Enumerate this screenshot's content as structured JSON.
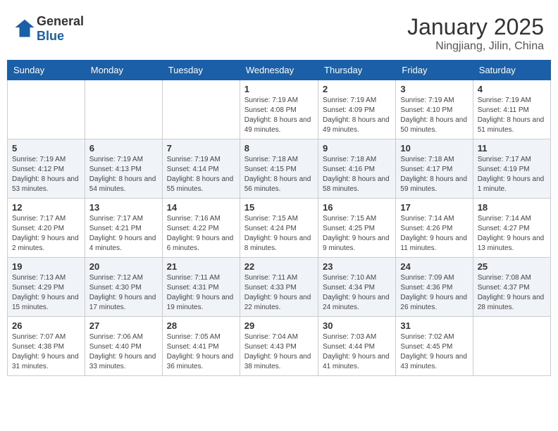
{
  "logo": {
    "general": "General",
    "blue": "Blue"
  },
  "title": "January 2025",
  "location": "Ningjiang, Jilin, China",
  "days_of_week": [
    "Sunday",
    "Monday",
    "Tuesday",
    "Wednesday",
    "Thursday",
    "Friday",
    "Saturday"
  ],
  "weeks": [
    [
      {
        "day": "",
        "sunrise": "",
        "sunset": "",
        "daylight": ""
      },
      {
        "day": "",
        "sunrise": "",
        "sunset": "",
        "daylight": ""
      },
      {
        "day": "",
        "sunrise": "",
        "sunset": "",
        "daylight": ""
      },
      {
        "day": "1",
        "sunrise": "Sunrise: 7:19 AM",
        "sunset": "Sunset: 4:08 PM",
        "daylight": "Daylight: 8 hours and 49 minutes."
      },
      {
        "day": "2",
        "sunrise": "Sunrise: 7:19 AM",
        "sunset": "Sunset: 4:09 PM",
        "daylight": "Daylight: 8 hours and 49 minutes."
      },
      {
        "day": "3",
        "sunrise": "Sunrise: 7:19 AM",
        "sunset": "Sunset: 4:10 PM",
        "daylight": "Daylight: 8 hours and 50 minutes."
      },
      {
        "day": "4",
        "sunrise": "Sunrise: 7:19 AM",
        "sunset": "Sunset: 4:11 PM",
        "daylight": "Daylight: 8 hours and 51 minutes."
      }
    ],
    [
      {
        "day": "5",
        "sunrise": "Sunrise: 7:19 AM",
        "sunset": "Sunset: 4:12 PM",
        "daylight": "Daylight: 8 hours and 53 minutes."
      },
      {
        "day": "6",
        "sunrise": "Sunrise: 7:19 AM",
        "sunset": "Sunset: 4:13 PM",
        "daylight": "Daylight: 8 hours and 54 minutes."
      },
      {
        "day": "7",
        "sunrise": "Sunrise: 7:19 AM",
        "sunset": "Sunset: 4:14 PM",
        "daylight": "Daylight: 8 hours and 55 minutes."
      },
      {
        "day": "8",
        "sunrise": "Sunrise: 7:18 AM",
        "sunset": "Sunset: 4:15 PM",
        "daylight": "Daylight: 8 hours and 56 minutes."
      },
      {
        "day": "9",
        "sunrise": "Sunrise: 7:18 AM",
        "sunset": "Sunset: 4:16 PM",
        "daylight": "Daylight: 8 hours and 58 minutes."
      },
      {
        "day": "10",
        "sunrise": "Sunrise: 7:18 AM",
        "sunset": "Sunset: 4:17 PM",
        "daylight": "Daylight: 8 hours and 59 minutes."
      },
      {
        "day": "11",
        "sunrise": "Sunrise: 7:17 AM",
        "sunset": "Sunset: 4:19 PM",
        "daylight": "Daylight: 9 hours and 1 minute."
      }
    ],
    [
      {
        "day": "12",
        "sunrise": "Sunrise: 7:17 AM",
        "sunset": "Sunset: 4:20 PM",
        "daylight": "Daylight: 9 hours and 2 minutes."
      },
      {
        "day": "13",
        "sunrise": "Sunrise: 7:17 AM",
        "sunset": "Sunset: 4:21 PM",
        "daylight": "Daylight: 9 hours and 4 minutes."
      },
      {
        "day": "14",
        "sunrise": "Sunrise: 7:16 AM",
        "sunset": "Sunset: 4:22 PM",
        "daylight": "Daylight: 9 hours and 6 minutes."
      },
      {
        "day": "15",
        "sunrise": "Sunrise: 7:15 AM",
        "sunset": "Sunset: 4:24 PM",
        "daylight": "Daylight: 9 hours and 8 minutes."
      },
      {
        "day": "16",
        "sunrise": "Sunrise: 7:15 AM",
        "sunset": "Sunset: 4:25 PM",
        "daylight": "Daylight: 9 hours and 9 minutes."
      },
      {
        "day": "17",
        "sunrise": "Sunrise: 7:14 AM",
        "sunset": "Sunset: 4:26 PM",
        "daylight": "Daylight: 9 hours and 11 minutes."
      },
      {
        "day": "18",
        "sunrise": "Sunrise: 7:14 AM",
        "sunset": "Sunset: 4:27 PM",
        "daylight": "Daylight: 9 hours and 13 minutes."
      }
    ],
    [
      {
        "day": "19",
        "sunrise": "Sunrise: 7:13 AM",
        "sunset": "Sunset: 4:29 PM",
        "daylight": "Daylight: 9 hours and 15 minutes."
      },
      {
        "day": "20",
        "sunrise": "Sunrise: 7:12 AM",
        "sunset": "Sunset: 4:30 PM",
        "daylight": "Daylight: 9 hours and 17 minutes."
      },
      {
        "day": "21",
        "sunrise": "Sunrise: 7:11 AM",
        "sunset": "Sunset: 4:31 PM",
        "daylight": "Daylight: 9 hours and 19 minutes."
      },
      {
        "day": "22",
        "sunrise": "Sunrise: 7:11 AM",
        "sunset": "Sunset: 4:33 PM",
        "daylight": "Daylight: 9 hours and 22 minutes."
      },
      {
        "day": "23",
        "sunrise": "Sunrise: 7:10 AM",
        "sunset": "Sunset: 4:34 PM",
        "daylight": "Daylight: 9 hours and 24 minutes."
      },
      {
        "day": "24",
        "sunrise": "Sunrise: 7:09 AM",
        "sunset": "Sunset: 4:36 PM",
        "daylight": "Daylight: 9 hours and 26 minutes."
      },
      {
        "day": "25",
        "sunrise": "Sunrise: 7:08 AM",
        "sunset": "Sunset: 4:37 PM",
        "daylight": "Daylight: 9 hours and 28 minutes."
      }
    ],
    [
      {
        "day": "26",
        "sunrise": "Sunrise: 7:07 AM",
        "sunset": "Sunset: 4:38 PM",
        "daylight": "Daylight: 9 hours and 31 minutes."
      },
      {
        "day": "27",
        "sunrise": "Sunrise: 7:06 AM",
        "sunset": "Sunset: 4:40 PM",
        "daylight": "Daylight: 9 hours and 33 minutes."
      },
      {
        "day": "28",
        "sunrise": "Sunrise: 7:05 AM",
        "sunset": "Sunset: 4:41 PM",
        "daylight": "Daylight: 9 hours and 36 minutes."
      },
      {
        "day": "29",
        "sunrise": "Sunrise: 7:04 AM",
        "sunset": "Sunset: 4:43 PM",
        "daylight": "Daylight: 9 hours and 38 minutes."
      },
      {
        "day": "30",
        "sunrise": "Sunrise: 7:03 AM",
        "sunset": "Sunset: 4:44 PM",
        "daylight": "Daylight: 9 hours and 41 minutes."
      },
      {
        "day": "31",
        "sunrise": "Sunrise: 7:02 AM",
        "sunset": "Sunset: 4:45 PM",
        "daylight": "Daylight: 9 hours and 43 minutes."
      },
      {
        "day": "",
        "sunrise": "",
        "sunset": "",
        "daylight": ""
      }
    ]
  ]
}
